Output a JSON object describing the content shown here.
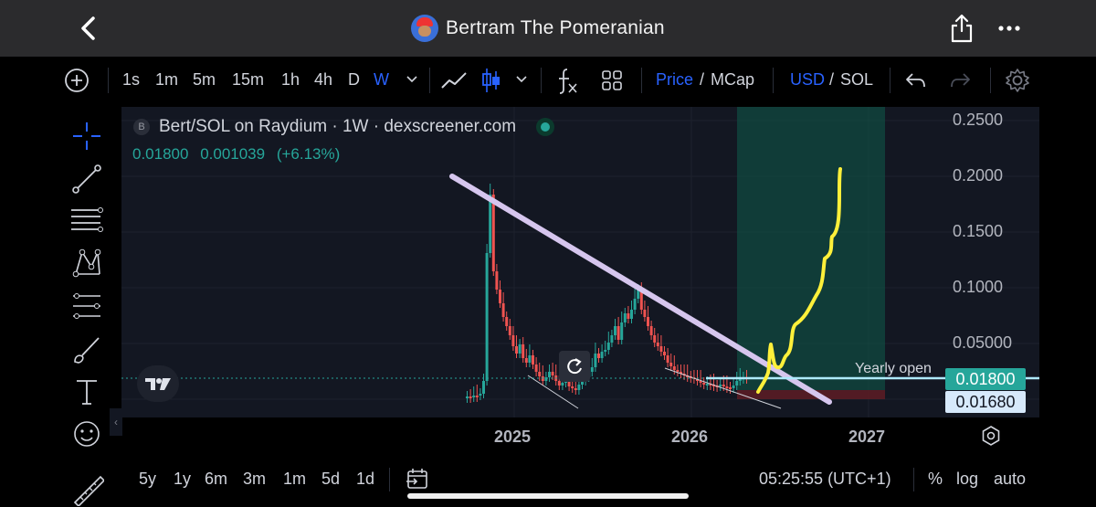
{
  "app": {
    "title": "Bertram The Pomeranian"
  },
  "toolbar": {
    "intervals": [
      "1s",
      "1m",
      "5m",
      "15m",
      "1h",
      "4h",
      "D",
      "W"
    ],
    "active_interval": "W",
    "price_label": "Price",
    "mcap_label": "MCap",
    "usd_label": "USD",
    "sol_label": "SOL",
    "sep": "/"
  },
  "chart": {
    "header_badge": "B",
    "header_title": "Bert/SOL on Raydium · 1W · dexscreener.com",
    "last_price": "0.01800",
    "change_abs": "0.001039",
    "change_pct": "(+6.13%)",
    "y_labels": [
      "0.2500",
      "0.2000",
      "0.1500",
      "0.1000",
      "0.05000"
    ],
    "price_tag_current": "0.01800",
    "price_tag_alt": "0.01680",
    "yearly_open_label": "Yearly open",
    "x_labels": [
      "2025",
      "2026",
      "2027"
    ]
  },
  "chart_data": {
    "type": "candlestick",
    "title": "Bert/SOL on Raydium · 1W · dexscreener.com",
    "x_ticks": [
      "2025",
      "2026",
      "2027"
    ],
    "y_ticks": [
      0.05,
      0.1,
      0.15,
      0.2,
      0.25
    ],
    "ylim": [
      0,
      0.26
    ],
    "last_price": 0.018,
    "yearly_open": 0.018,
    "annotations": [
      "falling trendline",
      "target box",
      "hand-drawn projected rise"
    ]
  },
  "bottombar": {
    "ranges": [
      "5y",
      "1y",
      "6m",
      "3m",
      "1m",
      "5d",
      "1d"
    ],
    "time": "05:25:55 (UTC+1)",
    "pct": "%",
    "log": "log",
    "auto": "auto"
  },
  "colors": {
    "up": "#26a69a",
    "down": "#ef5350",
    "accent": "#2962ff",
    "trend": "#d6c6ee",
    "drawing": "#fff03a"
  }
}
